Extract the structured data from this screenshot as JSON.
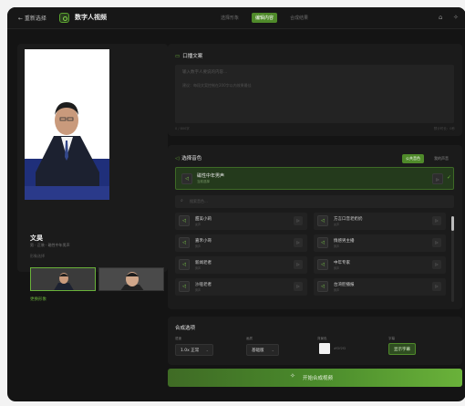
{
  "header": {
    "back_label": "← 重新选择",
    "title": "数字人视频",
    "steps": [
      "选择形象",
      "编辑内容",
      "合成结果"
    ],
    "active_step": 1,
    "icons": [
      "home-icon",
      "settings-icon"
    ]
  },
  "avatar": {
    "name": "文昊",
    "desc": "男 · 正装 · 磁性中年男声",
    "section_label": "形象选择",
    "more_label": "更换形象"
  },
  "script_panel": {
    "title": "口播文案",
    "placeholder": "输入数字人要说的内容...",
    "hint": "建议：每段文案控制在200字以内效果最佳",
    "count_left": "0 / 800字",
    "count_right": "预计时长：0秒"
  },
  "voice_panel": {
    "title": "选择音色",
    "tabs": [
      "公共音色",
      "我的声音"
    ],
    "active_tab": 0,
    "selected": {
      "name": "磁性中年男声",
      "sub": "当前选择"
    },
    "search_placeholder": "搜索音色...",
    "voices": [
      {
        "name": "甜美小莉",
        "sub": "女声"
      },
      {
        "name": "方言口音老奶奶",
        "sub": "女声"
      },
      {
        "name": "嘉禾小哥",
        "sub": "男声"
      },
      {
        "name": "情感男主播",
        "sub": "男声"
      },
      {
        "name": "新闻老者",
        "sub": "男声"
      },
      {
        "name": "中年专家",
        "sub": "男声"
      },
      {
        "name": "沙哑老者",
        "sub": "男声"
      },
      {
        "name": "台湾腔播报",
        "sub": "男声"
      }
    ]
  },
  "options": {
    "title": "合成选项",
    "speed_label": "语速",
    "speed_value": "1.0x 正常",
    "style_label": "画质",
    "style_value": "基础版",
    "bg_label": "背景色",
    "bg_value": "#f2f2f2",
    "subtitle_label": "字幕",
    "subtitle_value": "显示字幕"
  },
  "generate_label": "开始合成视频",
  "colors": {
    "accent": "#4f8a2a",
    "panel": "#1b1b1b"
  }
}
